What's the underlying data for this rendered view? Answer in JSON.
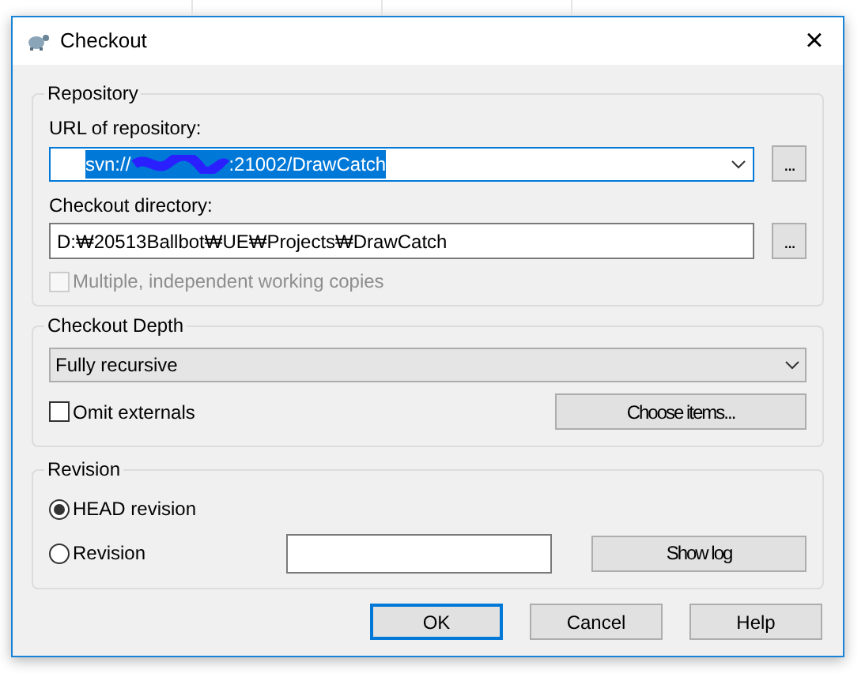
{
  "window": {
    "title": "Checkout",
    "close": "×"
  },
  "repository": {
    "title": "Repository",
    "url_label": "URL of repository:",
    "url_prefix": "svn://",
    "url_suffix": ":21002/DrawCatch",
    "url_redacted": true,
    "url_browse": "...",
    "dir_label": "Checkout directory:",
    "dir_value": "D:₩20513Ballbot₩UE₩Projects₩DrawCatch",
    "dir_browse": "...",
    "multiple": {
      "label": "Multiple, independent working copies",
      "checked": false,
      "disabled": true
    }
  },
  "depth": {
    "title": "Checkout Depth",
    "value": "Fully recursive",
    "omit": {
      "label": "Omit externals",
      "checked": false,
      "disabled": false
    },
    "choose": "Choose items..."
  },
  "revision": {
    "title": "Revision",
    "options": [
      {
        "label": "HEAD revision",
        "selected": true
      },
      {
        "label": "Revision",
        "selected": false
      }
    ],
    "show_log": "Show log"
  },
  "buttons": [
    {
      "label": "OK",
      "default": true
    },
    {
      "label": "Cancel",
      "default": false
    },
    {
      "label": "Help",
      "default": false
    }
  ]
}
